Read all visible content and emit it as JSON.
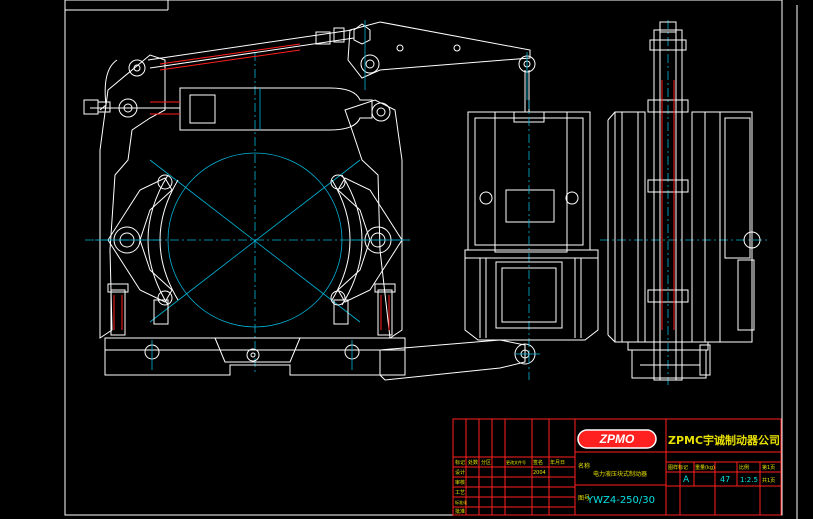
{
  "title_block": {
    "logo_text": "ZPMO",
    "company": "ZPMC宇诚制动器公司",
    "product_name": "电力液压块式制动器",
    "model": "YWZ4-250/30",
    "grade": "A",
    "weight": "47",
    "scale": "1:2.5",
    "sheet": "第1页",
    "sheet_count": "共1页",
    "date_code": "2004",
    "col_labels": [
      "标记",
      "处数",
      "分区",
      "更改文件号",
      "签名",
      "年月日"
    ],
    "row_labels": [
      "设计",
      "审核",
      "工艺",
      "标准化",
      "批准"
    ],
    "stage_labels": [
      "图样标记",
      "重量(kg)",
      "比例"
    ],
    "side_label_a": "名称",
    "side_label_b": "图号"
  },
  "colors": {
    "background": "#000000",
    "outline": "#ffffff",
    "centerline": "#00b4d8",
    "hidden_red": "#ff2020",
    "text_yellow": "#e8e000",
    "text_cyan": "#00e0e0"
  }
}
